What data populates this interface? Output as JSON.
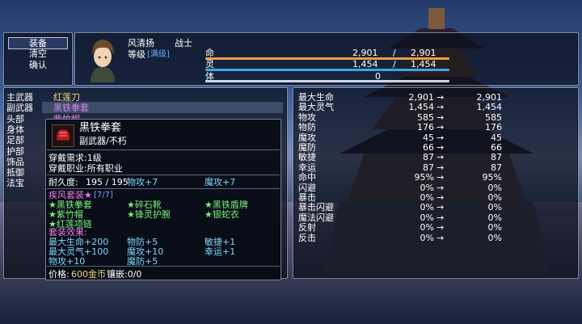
{
  "menu": {
    "items": [
      "装备",
      "清空",
      "确认"
    ],
    "selected_index": 0
  },
  "character": {
    "name": "风清扬",
    "class": "战士",
    "level_label": "等级",
    "level_value": "[满级]",
    "hp": {
      "label": "命",
      "current": "2,901",
      "sep": "/",
      "max": "2,901",
      "fraction": 1.0
    },
    "mp": {
      "label": "灵",
      "current": "1,454",
      "sep": "/",
      "max": "1,454",
      "fraction": 1.0
    },
    "stamina": {
      "label": "体",
      "value": "0",
      "fraction": 0.0
    }
  },
  "slots": [
    {
      "label": "主武器",
      "item": "红莲刀",
      "color": "#f3d670"
    },
    {
      "label": "副武器",
      "item": "黑铁拳套",
      "color": "#f07ce8"
    },
    {
      "label": "头部",
      "item": "紫竹帽",
      "color": "#f07ce8"
    },
    {
      "label": "身体",
      "item": "",
      "color": "#ffffff"
    },
    {
      "label": "足部",
      "item": "",
      "color": "#ffffff"
    },
    {
      "label": "护部",
      "item": "",
      "color": "#ffffff"
    },
    {
      "label": "饰品",
      "item": "",
      "color": "#ffffff"
    },
    {
      "label": "抵御",
      "item": "",
      "color": "#ffffff"
    },
    {
      "label": "法宝",
      "item": "",
      "color": "#ffffff"
    }
  ],
  "tooltip": {
    "name": "黑铁拳套",
    "type": "副武器/不朽",
    "req_level": "穿戴需求:1级",
    "req_class": "穿戴职业:所有职业",
    "durability_label": "耐久度:",
    "durability": "195 / 195",
    "attack": "物攻+7",
    "magic_attack": "魔攻+7",
    "set_title": "疾风套装★",
    "set_count": "[7/7]",
    "set_items": [
      "★黑铁拳套",
      "★碎石靴",
      "★黑铁盾牌",
      "★紫竹帽",
      "★锋灵护腕",
      "★银蛇衣",
      "★红莲项链"
    ],
    "effect_title": "套装效果:",
    "effects": [
      "最大生命+200",
      "物防+5",
      "敏捷+1",
      "最大灵气+100",
      "魔攻+10",
      "幸运+1",
      "物攻+10",
      "魔防+5"
    ],
    "price_label": "价格:",
    "price": "600金币",
    "socket": "镶嵌:0/0"
  },
  "stats": [
    {
      "name": "最大生命",
      "cur": "2,901",
      "arrow": "→",
      "new": "2,901"
    },
    {
      "name": "最大灵气",
      "cur": "1,454",
      "arrow": "→",
      "new": "1,454"
    },
    {
      "name": "物攻",
      "cur": "585",
      "arrow": "→",
      "new": "585"
    },
    {
      "name": "物防",
      "cur": "176",
      "arrow": "→",
      "new": "176"
    },
    {
      "name": "魔攻",
      "cur": "45",
      "arrow": "→",
      "new": "45"
    },
    {
      "name": "魔防",
      "cur": "66",
      "arrow": "→",
      "new": "66"
    },
    {
      "name": "敏捷",
      "cur": "87",
      "arrow": "→",
      "new": "87"
    },
    {
      "name": "幸运",
      "cur": "87",
      "arrow": "→",
      "new": "87"
    },
    {
      "name": "命中",
      "cur": "95%",
      "arrow": "→",
      "new": "95%"
    },
    {
      "name": "闪避",
      "cur": "0%",
      "arrow": "→",
      "new": "0%"
    },
    {
      "name": "暴击",
      "cur": "0%",
      "arrow": "→",
      "new": "0%"
    },
    {
      "name": "暴击闪避",
      "cur": "0%",
      "arrow": "→",
      "new": "0%"
    },
    {
      "name": "魔法闪避",
      "cur": "0%",
      "arrow": "→",
      "new": "0%"
    },
    {
      "name": "反射",
      "cur": "0%",
      "arrow": "→",
      "new": "0%"
    },
    {
      "name": "反击",
      "cur": "0%",
      "arrow": "→",
      "new": "0%"
    }
  ],
  "colors": {
    "hp": "#e8a040",
    "mp": "#3aa8e8",
    "stamina": "#cfd6e6",
    "window_border": "#dce6ff"
  }
}
